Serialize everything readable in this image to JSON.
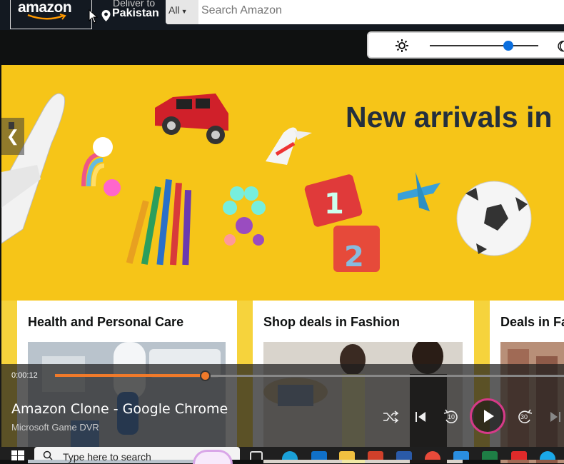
{
  "header": {
    "logo_text": "amazon",
    "deliver_line1": "Deliver to",
    "deliver_line2": "Pakistan",
    "search_category": "All",
    "search_placeholder": "Search Amazon"
  },
  "hero": {
    "title": "New arrivals in",
    "prev_arrow": "❮"
  },
  "cards": [
    {
      "title": "Health and Personal Care"
    },
    {
      "title": "Shop deals in Fashion"
    },
    {
      "title": "Deals in Fa"
    }
  ],
  "player": {
    "elapsed": "0:00:12",
    "progress_fraction": 0.3,
    "title": "Amazon Clone - Google Chrome",
    "subtitle": "Microsoft Game DVR",
    "rewind_label": "10",
    "forward_label": "30"
  },
  "taskbar": {
    "search_text": "Type here to search"
  },
  "colors": {
    "header_bg": "#131921",
    "hero_bg": "#f6c518",
    "progress": "#f07a2a",
    "slider_knob": "#0a6ede"
  }
}
